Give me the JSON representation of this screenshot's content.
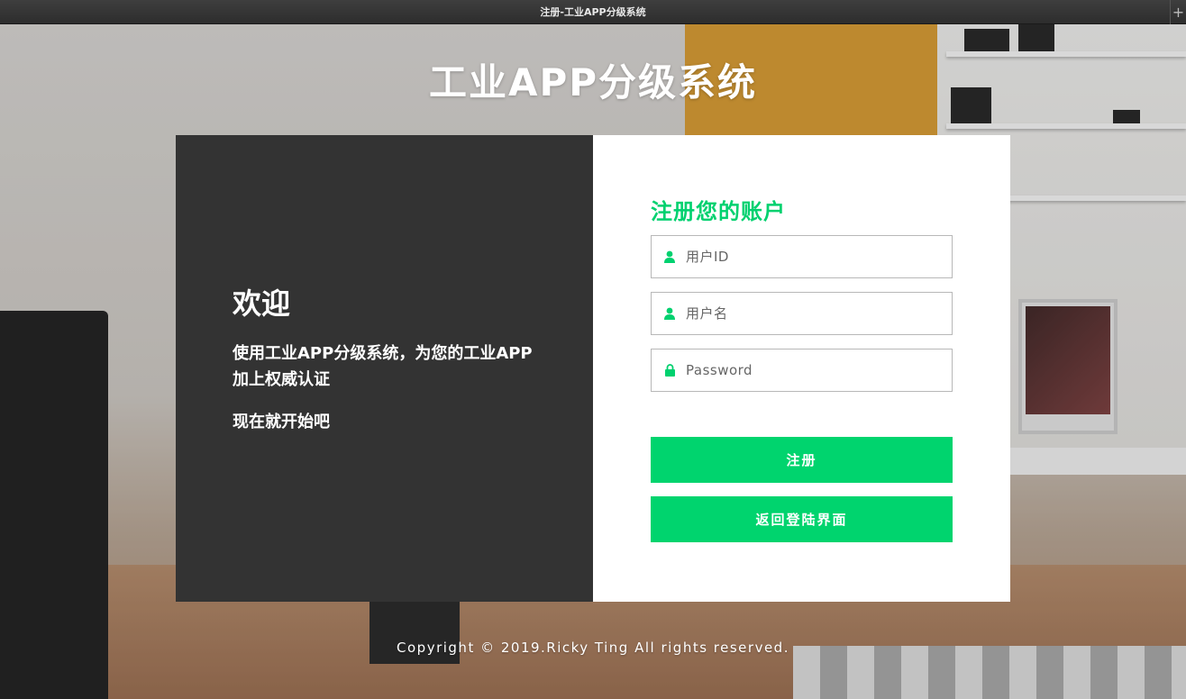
{
  "window": {
    "title": "注册-工业APP分级系统",
    "new_tab": "+"
  },
  "header": {
    "title": "工业APP分级系统"
  },
  "welcome_panel": {
    "heading": "欢迎",
    "description": "使用工业APP分级系统，为您的工业APP加上权威认证",
    "cta": "现在就开始吧"
  },
  "register_form": {
    "title": "注册您的账户",
    "fields": [
      {
        "icon": "user-icon",
        "placeholder": "用户ID"
      },
      {
        "icon": "user-icon",
        "placeholder": "用户名"
      },
      {
        "icon": "lock-icon",
        "placeholder": "Password"
      }
    ],
    "submit_label": "注册",
    "back_label": "返回登陆界面"
  },
  "footer": {
    "copyright": "Copyright © 2019.Ricky Ting All rights reserved."
  },
  "colors": {
    "accent": "#00d46e",
    "panel_dark": "#333333",
    "panel_light": "#ffffff"
  }
}
